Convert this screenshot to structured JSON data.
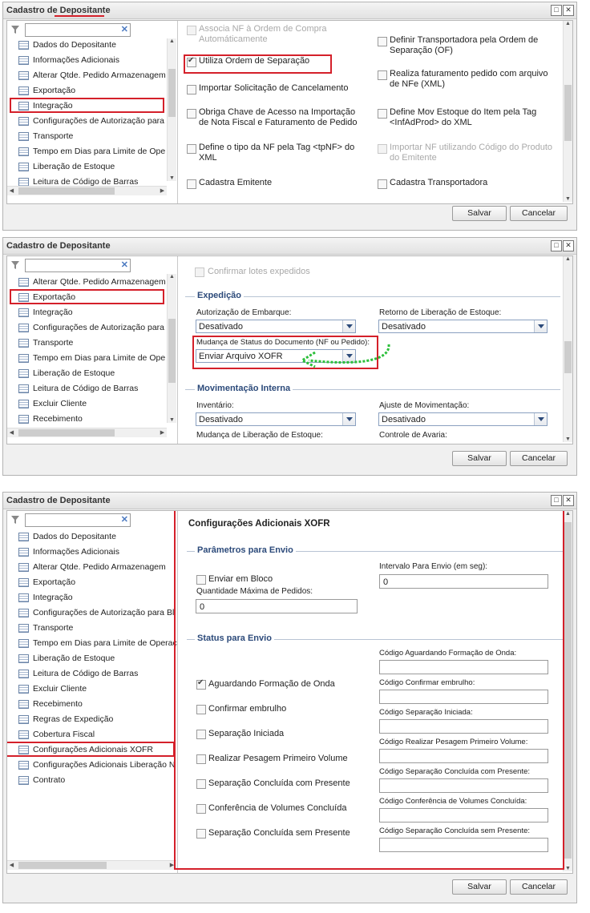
{
  "window_title": "Cadastro de Depositante",
  "footer": {
    "save_label": "Salvar",
    "cancel_label": "Cancelar"
  },
  "panel1": {
    "tree": [
      "Dados do Depositante",
      "Informações Adicionais",
      "Alterar Qtde. Pedido Armazenagem",
      "Exportação",
      "Integração",
      "Configurações de Autorização para",
      "Transporte",
      "Tempo em Dias para Limite de Ope",
      "Liberação de Estoque",
      "Leitura de Código de Barras"
    ],
    "options_left": [
      {
        "label": "Associa NF à Ordem de Compra Automáticamente",
        "checked": false,
        "disabled": true
      },
      {
        "label": "Utiliza Ordem de Separação",
        "checked": true,
        "disabled": false
      },
      {
        "label": "Importar Solicitação de Cancelamento",
        "checked": false,
        "disabled": false
      },
      {
        "label": "Obriga Chave de Acesso na Importação de Nota Fiscal e Faturamento de Pedido",
        "checked": false,
        "disabled": false
      },
      {
        "label": "Define o tipo da NF pela Tag <tpNF> do XML",
        "checked": false,
        "disabled": false
      },
      {
        "label": "Cadastra Emitente",
        "checked": false,
        "disabled": false
      }
    ],
    "options_right": [
      {
        "label": "Definir Transportadora pela Ordem de Separação (OF)",
        "checked": false,
        "disabled": false
      },
      {
        "label": "Realiza faturamento pedido com arquivo de NFe (XML)",
        "checked": false,
        "disabled": false
      },
      {
        "label": "Define Mov Estoque do Item pela Tag <InfAdProd> do XML",
        "checked": false,
        "disabled": false
      },
      {
        "label": "Importar NF utilizando Código do Produto do Emitente",
        "checked": false,
        "disabled": true
      },
      {
        "label": "Cadastra Transportadora",
        "checked": false,
        "disabled": false
      }
    ]
  },
  "panel2": {
    "tree": [
      "Alterar Qtde. Pedido Armazenagem",
      "Exportação",
      "Integração",
      "Configurações de Autorização para",
      "Transporte",
      "Tempo em Dias para Limite de Ope",
      "Liberação de Estoque",
      "Leitura de Código de Barras",
      "Excluir Cliente",
      "Recebimento"
    ],
    "top_option": "Confirmar lotes expedidos",
    "expedicao": {
      "title": "Expedição",
      "auth_label": "Autorização de Embarque:",
      "auth_value": "Desativado",
      "ret_label": "Retorno de Liberação de Estoque:",
      "ret_value": "Desativado",
      "status_label": "Mudança de Status do Documento (NF ou Pedido):",
      "status_value": "Enviar Arquivo XOFR"
    },
    "mov": {
      "title": "Movimentação Interna",
      "inv_label": "Inventário:",
      "inv_value": "Desativado",
      "ajuste_label": "Ajuste de Movimentação:",
      "ajuste_value": "Desativado",
      "lib_label": "Mudança de Liberação de Estoque:",
      "avaria_label": "Controle de Avaria:"
    }
  },
  "panel3": {
    "tree": [
      "Dados do Depositante",
      "Informações Adicionais",
      "Alterar Qtde. Pedido Armazenagem",
      "Exportação",
      "Integração",
      "Configurações de Autorização para Bl",
      "Transporte",
      "Tempo em Dias para Limite de Operaç",
      "Liberação de Estoque",
      "Leitura de Código de Barras",
      "Excluir Cliente",
      "Recebimento",
      "Regras de Expedição",
      "Cobertura Fiscal",
      "Configurações Adicionais XOFR",
      "Configurações Adicionais Liberação N",
      "Contrato"
    ],
    "heading": "Configurações Adicionais XOFR",
    "params": {
      "title": "Parâmetros para Envio",
      "enviar_bloco": "Enviar em Bloco",
      "qtd_label": "Quantidade Máxima de Pedidos:",
      "qtd_value": "0",
      "intervalo_label": "Intervalo Para Envio (em seg):",
      "intervalo_value": "0"
    },
    "status": {
      "title": "Status para Envio",
      "items": [
        {
          "label": "Aguardando Formação de Onda",
          "checked": true,
          "code_label": "Código Aguardando Formação de Onda:"
        },
        {
          "label": "Confirmar embrulho",
          "checked": false,
          "code_label": "Código Confirmar embrulho:"
        },
        {
          "label": "Separação Iniciada",
          "checked": false,
          "code_label": "Código Separação Iniciada:"
        },
        {
          "label": "Realizar Pesagem Primeiro Volume",
          "checked": false,
          "code_label": "Código Realizar Pesagem Primeiro Volume:"
        },
        {
          "label": "Separação Concluída com Presente",
          "checked": false,
          "code_label": "Código Separação Concluída com Presente:"
        },
        {
          "label": "Conferência de Volumes Concluída",
          "checked": false,
          "code_label": "Código Conferência de Volumes Concluída:"
        },
        {
          "label": "Separação Concluída sem Presente",
          "checked": false,
          "code_label": "Código Separação Concluída sem Presente:"
        }
      ]
    }
  }
}
